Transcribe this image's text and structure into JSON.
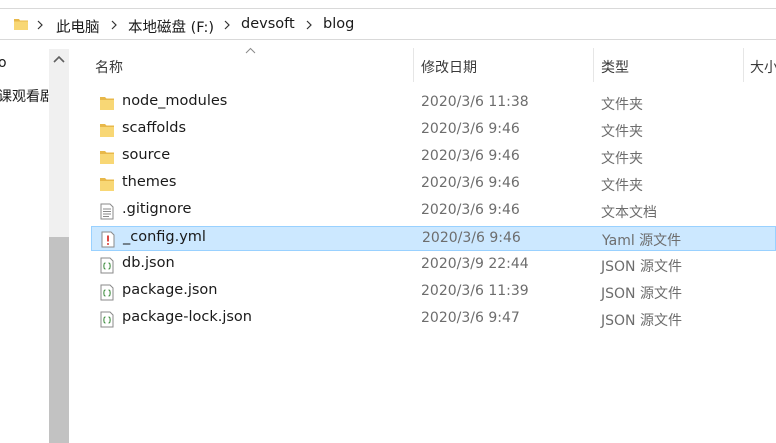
{
  "breadcrumb": [
    "此电脑",
    "本地磁盘 (F:)",
    "devsoft",
    "blog"
  ],
  "nav": {
    "items": [
      "o",
      "课观看剧"
    ]
  },
  "columns": {
    "name": "名称",
    "modified": "修改日期",
    "type": "类型",
    "size": "大小"
  },
  "files": [
    {
      "name": "node_modules",
      "modified": "2020/3/6 11:38",
      "type": "文件夹",
      "icon": "folder-icon"
    },
    {
      "name": "scaffolds",
      "modified": "2020/3/6 9:46",
      "type": "文件夹",
      "icon": "folder-icon"
    },
    {
      "name": "source",
      "modified": "2020/3/6 9:46",
      "type": "文件夹",
      "icon": "folder-icon"
    },
    {
      "name": "themes",
      "modified": "2020/3/6 9:46",
      "type": "文件夹",
      "icon": "folder-icon"
    },
    {
      "name": ".gitignore",
      "modified": "2020/3/6 9:46",
      "type": "文本文档",
      "icon": "text-file-icon"
    },
    {
      "name": "_config.yml",
      "modified": "2020/3/6 9:46",
      "type": "Yaml 源文件",
      "icon": "yaml-file-icon",
      "selected": true
    },
    {
      "name": "db.json",
      "modified": "2020/3/9 22:44",
      "type": "JSON 源文件",
      "icon": "json-file-icon"
    },
    {
      "name": "package.json",
      "modified": "2020/3/6 11:39",
      "type": "JSON 源文件",
      "icon": "json-file-icon"
    },
    {
      "name": "package-lock.json",
      "modified": "2020/3/6 9:47",
      "type": "JSON 源文件",
      "icon": "json-file-icon"
    }
  ],
  "colors": {
    "folder": "#f8d775",
    "selection": "#cce8ff",
    "selection_border": "#99d1ff"
  }
}
